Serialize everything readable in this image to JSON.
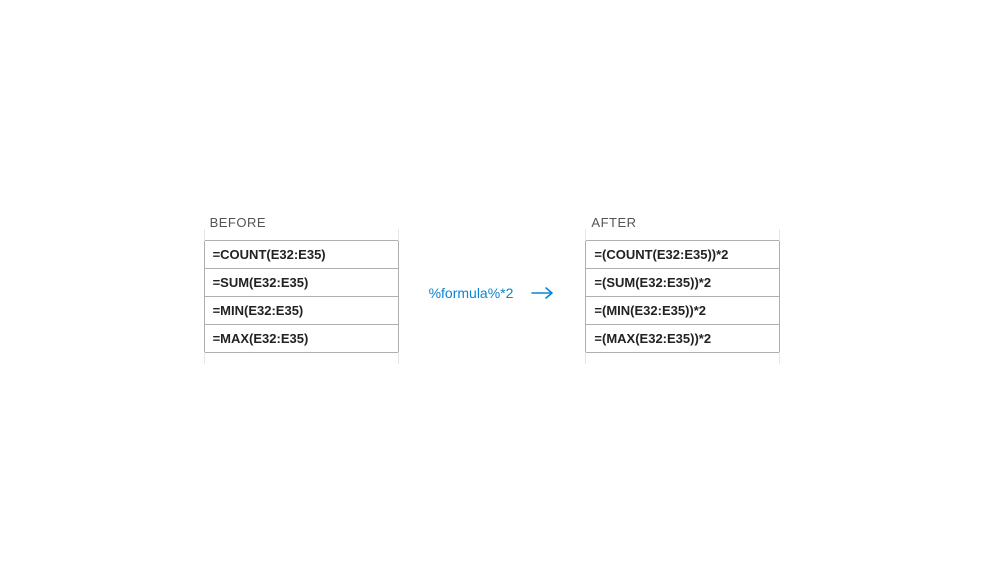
{
  "before": {
    "label": "BEFORE",
    "cells": [
      "=COUNT(E32:E35)",
      "=SUM(E32:E35)",
      "=MIN(E32:E35)",
      "=MAX(E32:E35)"
    ]
  },
  "after": {
    "label": "AFTER",
    "cells": [
      "=(COUNT(E32:E35))*2",
      "=(SUM(E32:E35))*2",
      "=(MIN(E32:E35))*2",
      "=(MAX(E32:E35))*2"
    ]
  },
  "transform": {
    "expression": "%formula%*2"
  }
}
